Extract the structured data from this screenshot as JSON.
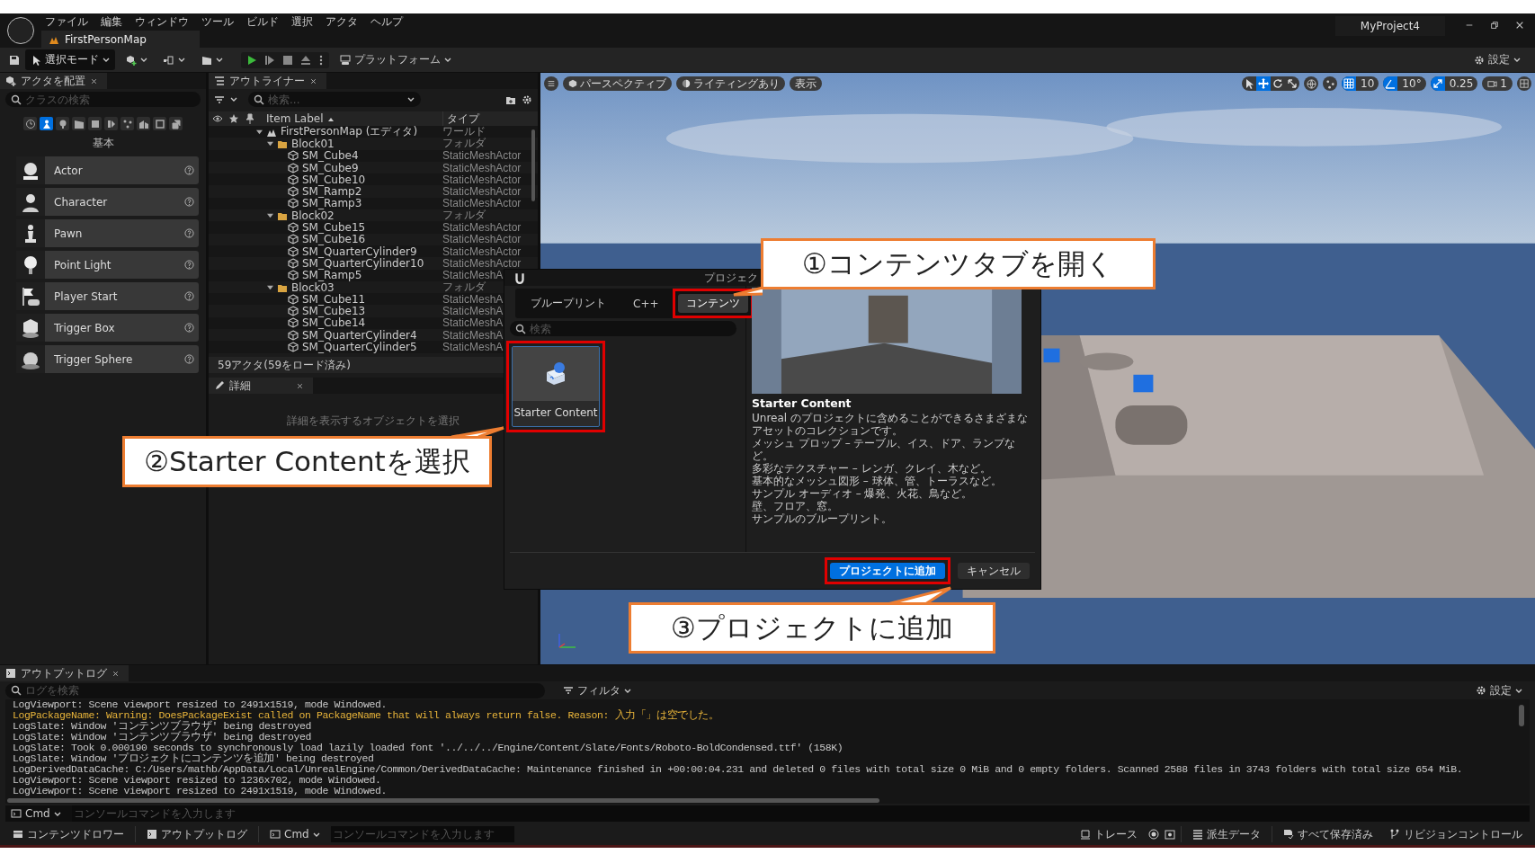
{
  "app": {
    "menu": [
      "ファイル",
      "編集",
      "ウィンドウ",
      "ツール",
      "ビルド",
      "選択",
      "アクタ",
      "ヘルプ"
    ],
    "document_tab": {
      "label": "FirstPersonMap",
      "selected": true
    },
    "project": "MyProject4"
  },
  "toolbar": {
    "mode": "選択モード",
    "platform": "プラットフォーム",
    "settings": "設定"
  },
  "place_actors": {
    "tab": "アクタを配置",
    "search": {
      "placeholder": "クラスの検索"
    },
    "categories": [
      {
        "kind": "recent",
        "selected": false
      },
      {
        "kind": "basic",
        "selected": true
      },
      {
        "kind": "lights",
        "selected": false
      },
      {
        "kind": "cinematic",
        "selected": false
      },
      {
        "kind": "visual",
        "selected": false
      },
      {
        "kind": "volumes",
        "selected": false
      },
      {
        "kind": "effects",
        "selected": false
      },
      {
        "kind": "geometry",
        "selected": false
      },
      {
        "kind": "shapes",
        "selected": false
      },
      {
        "kind": "all",
        "selected": false
      }
    ],
    "category_label": "基本",
    "items": [
      {
        "label": "Actor",
        "kind": "actor"
      },
      {
        "label": "Character",
        "kind": "character"
      },
      {
        "label": "Pawn",
        "kind": "pawn"
      },
      {
        "label": "Point Light",
        "kind": "light"
      },
      {
        "label": "Player Start",
        "kind": "start"
      },
      {
        "label": "Trigger Box",
        "kind": "box"
      },
      {
        "label": "Trigger Sphere",
        "kind": "sphere"
      }
    ]
  },
  "outliner": {
    "tab": "アウトライナー",
    "search": {
      "placeholder": "検索..."
    },
    "columns": [
      "Item Label",
      "タイプ"
    ],
    "tree": [
      {
        "label": "FirstPersonMap (エディタ)",
        "type": "ワールド",
        "kind": "world",
        "expanded": true,
        "children": [
          {
            "label": "Block01",
            "type": "フォルダ",
            "kind": "folder",
            "expanded": true,
            "children": [
              {
                "label": "SM_Cube4",
                "type": "StaticMeshActor",
                "kind": "mesh"
              },
              {
                "label": "SM_Cube9",
                "type": "StaticMeshActor",
                "kind": "mesh"
              },
              {
                "label": "SM_Cube10",
                "type": "StaticMeshActor",
                "kind": "mesh"
              },
              {
                "label": "SM_Ramp2",
                "type": "StaticMeshActor",
                "kind": "mesh"
              },
              {
                "label": "SM_Ramp3",
                "type": "StaticMeshActor",
                "kind": "mesh"
              }
            ]
          },
          {
            "label": "Block02",
            "type": "フォルダ",
            "kind": "folder",
            "expanded": true,
            "children": [
              {
                "label": "SM_Cube15",
                "type": "StaticMeshActor",
                "kind": "mesh"
              },
              {
                "label": "SM_Cube16",
                "type": "StaticMeshActor",
                "kind": "mesh"
              },
              {
                "label": "SM_QuarterCylinder9",
                "type": "StaticMeshActor",
                "kind": "mesh"
              },
              {
                "label": "SM_QuarterCylinder10",
                "type": "StaticMeshActor",
                "kind": "mesh"
              },
              {
                "label": "SM_Ramp5",
                "type": "StaticMeshA",
                "kind": "mesh"
              }
            ]
          },
          {
            "label": "Block03",
            "type": "フォルダ",
            "kind": "folder",
            "expanded": true,
            "children": [
              {
                "label": "SM_Cube11",
                "type": "StaticMeshA",
                "kind": "mesh"
              },
              {
                "label": "SM_Cube13",
                "type": "StaticMeshA",
                "kind": "mesh"
              },
              {
                "label": "SM_Cube14",
                "type": "StaticMeshA",
                "kind": "mesh"
              },
              {
                "label": "SM_QuarterCylinder4",
                "type": "StaticMeshA",
                "kind": "mesh"
              },
              {
                "label": "SM_QuarterCylinder5",
                "type": "StaticMeshA",
                "kind": "mesh"
              }
            ]
          }
        ]
      }
    ],
    "footer": "59アクタ(59をロード済み)"
  },
  "details": {
    "tab": "詳細",
    "empty_text": "詳細を表示するオブジェクトを選択"
  },
  "viewport": {
    "view_menus": [
      {
        "label": "パースペクティブ",
        "kind": "perspective"
      },
      {
        "label": "ライティングあり",
        "kind": "lit"
      },
      {
        "label": "表示",
        "kind": "show"
      }
    ],
    "transform_tools": [
      {
        "kind": "select",
        "selected": false
      },
      {
        "kind": "move",
        "selected": true
      },
      {
        "kind": "rotate",
        "selected": false
      },
      {
        "kind": "scale",
        "selected": false
      }
    ],
    "snaps": [
      {
        "kind": "grid",
        "value": "10",
        "on": true
      },
      {
        "kind": "angle",
        "value": "10°",
        "on": true
      },
      {
        "kind": "scale",
        "value": "0.25",
        "on": true
      }
    ],
    "camera_speed": "1"
  },
  "dialog": {
    "title": "プロジェク",
    "tabs": [
      {
        "label": "ブループリント",
        "selected": false,
        "highlighted": false
      },
      {
        "label": "C++",
        "selected": false,
        "highlighted": false
      },
      {
        "label": "コンテンツ",
        "selected": true,
        "highlighted": true
      }
    ],
    "search": {
      "placeholder": "検索"
    },
    "tiles": [
      {
        "label": "Starter Content",
        "selected": true,
        "highlighted": true
      }
    ],
    "heading": "Starter Content",
    "description": [
      "Unreal のプロジェクトに含めることができるさまざまなアセットのコレクションです。",
      "メッシュ プロップ – テーブル、イス、ドア、ランプなど。",
      "多彩なテクスチャー – レンガ、クレイ、木など。",
      "基本的なメッシュ図形 – 球体、管、トーラスなど。",
      "サンプル オーディオ – 爆発、火花、鳥など。",
      "壁、フロア、窓。",
      "サンプルのブループリント。"
    ],
    "buttons": [
      {
        "label": "プロジェクトに追加",
        "kind": "primary",
        "highlighted": true
      },
      {
        "label": "キャンセル",
        "kind": "secondary",
        "highlighted": false
      }
    ]
  },
  "output_log": {
    "tab": "アウトプットログ",
    "search": {
      "placeholder": "ログを検索"
    },
    "filter": "フィルタ",
    "settings": "設定",
    "lines": [
      {
        "text": "LogViewport: Scene viewport resized to 2491x1519, mode Windowed.",
        "kind": "info"
      },
      {
        "text": "LogPackageName: Warning: DoesPackageExist called on PackageName that will always return false. Reason: 入力「」は空でした。",
        "kind": "warning"
      },
      {
        "text": "LogSlate: Window 'コンテンツブラウザ' being destroyed",
        "kind": "info"
      },
      {
        "text": "LogSlate: Window 'コンテンツブラウザ' being destroyed",
        "kind": "info"
      },
      {
        "text": "LogSlate: Took 0.000190 seconds to synchronously load lazily loaded font '../../../Engine/Content/Slate/Fonts/Roboto-BoldCondensed.ttf' (158K)",
        "kind": "info"
      },
      {
        "text": "LogSlate: Window 'プロジェクトにコンテンツを追加' being destroyed",
        "kind": "info"
      },
      {
        "text": "LogDerivedDataCache: C:/Users/mathb/AppData/Local/UnrealEngine/Common/DerivedDataCache: Maintenance finished in +00:00:04.231 and deleted 0 files with total size 0 MiB and 0 empty folders. Scanned 2588 files in 3743 folders with total size 654 MiB.",
        "kind": "info"
      },
      {
        "text": "LogViewport: Scene viewport resized to 1236x702, mode Windowed.",
        "kind": "info"
      },
      {
        "text": "LogViewport: Scene viewport resized to 2491x1519, mode Windowed.",
        "kind": "info"
      }
    ],
    "cmd": "Cmd",
    "console": {
      "placeholder": "コンソールコマンドを入力します"
    }
  },
  "status_bar": {
    "content_drawer": "コンテンツドロワー",
    "output_log": "アウトプットログ",
    "cmd": "Cmd",
    "console": {
      "placeholder": "コンソールコマンドを入力します"
    },
    "trace": "トレース",
    "derived_data": "派生データ",
    "save_state": "すべて保存済み",
    "revision_control": "リビジョンコントロール"
  },
  "callouts": [
    {
      "text": "①コンテンツタブを開く",
      "kind": "tab"
    },
    {
      "text": "②Starter Contentを選択",
      "kind": "tile"
    },
    {
      "text": "③プロジェクトに追加",
      "kind": "button"
    }
  ]
}
